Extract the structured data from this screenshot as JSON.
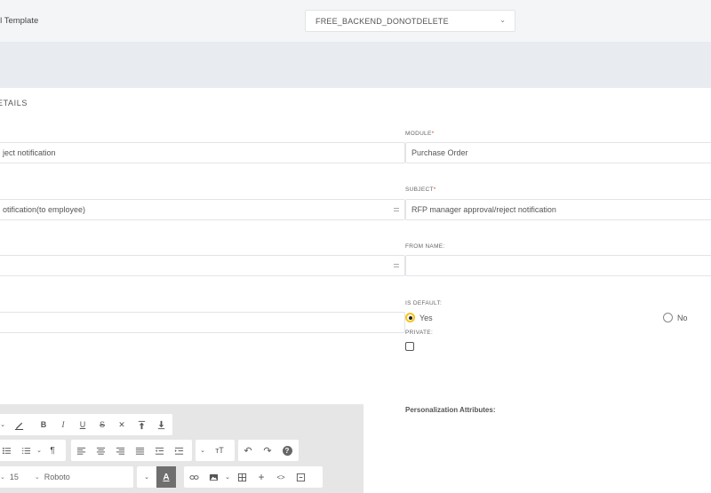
{
  "header": {
    "label": "il Template",
    "template_select": {
      "value": "FREE_BACKEND_DONOTDELETE",
      "chevron_icon": "chevron-down-icon"
    }
  },
  "section": {
    "title": "ETAILS"
  },
  "left_fields": {
    "name_value": "ject notification",
    "notification_value": "otification(to employee)",
    "field3_value": "",
    "field4_value": ""
  },
  "right_fields": {
    "module": {
      "label": "MODULE",
      "required_mark": "*",
      "value": "Purchase Order"
    },
    "subject": {
      "label": "SUBJECT",
      "required_mark": "*",
      "value": "RFP manager approval/reject notification"
    },
    "from_name": {
      "label": "FROM NAME:",
      "value": ""
    },
    "is_default": {
      "label": "IS DEFAULT:",
      "options": [
        "Yes",
        "No"
      ],
      "selected": "Yes"
    },
    "private": {
      "label": "PRIVATE:",
      "checked": false
    }
  },
  "editor": {
    "font_size": "15",
    "font_family": "Roboto",
    "toolbar_icons": [
      "pen-icon",
      "bold-icon",
      "italic-icon",
      "underline-icon",
      "strikethrough-icon",
      "clear-format-icon",
      "superscript-icon",
      "subscript-icon",
      "unordered-list-icon",
      "ordered-list-icon",
      "paragraph-format-icon",
      "align-left-icon",
      "align-center-icon",
      "align-right-icon",
      "align-justify-icon",
      "outdent-icon",
      "indent-icon",
      "line-height-icon",
      "undo-icon",
      "redo-icon",
      "help-icon",
      "text-color-icon",
      "link-icon",
      "image-icon",
      "table-icon",
      "plus-icon",
      "code-view-icon",
      "fullscreen-icon"
    ],
    "bold_glyph": "B",
    "italic_glyph": "I",
    "underline_glyph": "U",
    "strike_glyph": "S",
    "clear_glyph": "✕",
    "help_glyph": "?",
    "plus_glyph": "+",
    "code_glyph": "<>",
    "text_color_glyph": "A"
  },
  "personalization": {
    "title": "Personalization Attributes:"
  },
  "colors": {
    "accent": "#f5c518",
    "required": "#e53935",
    "topbar": "#f4f5f7",
    "band": "#e8ebf0",
    "editor_bg": "#e6e6e6"
  }
}
